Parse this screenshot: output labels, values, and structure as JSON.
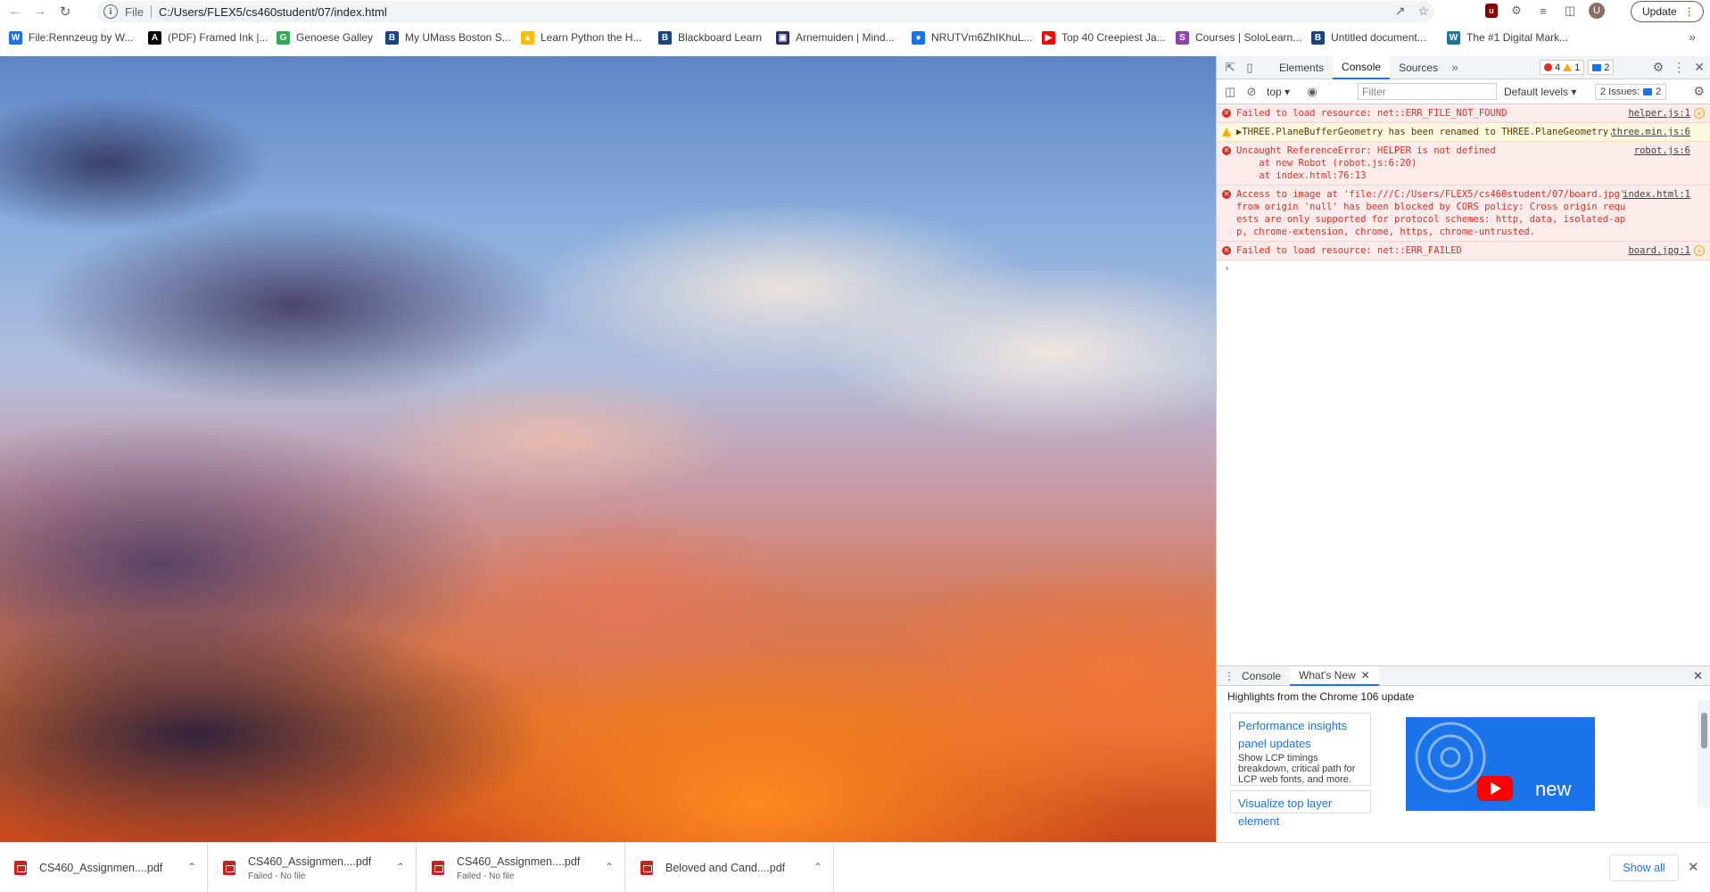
{
  "browser": {
    "url_scheme": "File",
    "url": "C:/Users/FLEX5/cs460student/07/index.html",
    "avatar_initial": "U",
    "update_label": "Update"
  },
  "bookmarks": [
    {
      "label": "File:Rennzeug by W...",
      "icon": "wiki-icon",
      "color": "#1a73e8"
    },
    {
      "label": "(PDF) Framed Ink |...",
      "icon": "academia-icon",
      "color": "#000000"
    },
    {
      "label": "Genoese Galley",
      "icon": "galley-icon",
      "color": "#34a853"
    },
    {
      "label": "My UMass Boston S...",
      "icon": "blackboard-icon",
      "color": "#1a4480"
    },
    {
      "label": "Learn Python the H...",
      "icon": "drive-icon",
      "color": "#fbbc04"
    },
    {
      "label": "Blackboard Learn",
      "icon": "blackboard-icon",
      "color": "#1a4480"
    },
    {
      "label": "Arnemuiden | Mind...",
      "icon": "image-icon",
      "color": "#2b2b6b"
    },
    {
      "label": "NRUTVm6ZhIKhuL...",
      "icon": "map-pin-icon",
      "color": "#1a73e8"
    },
    {
      "label": "Top 40 Creepiest Ja...",
      "icon": "youtube-icon",
      "color": "#ff0000"
    },
    {
      "label": "Courses | SoloLearn...",
      "icon": "sololearn-icon",
      "color": "#8e44ad"
    },
    {
      "label": "Untitled document...",
      "icon": "blackboard-icon",
      "color": "#1a4480"
    },
    {
      "label": "The #1 Digital Mark...",
      "icon": "wordpress-icon",
      "color": "#21759b"
    }
  ],
  "devtools": {
    "tabs": [
      "Elements",
      "Console",
      "Sources"
    ],
    "active_tab": "Console",
    "error_count": "4",
    "warning_count": "1",
    "message_count": "2",
    "context": "top",
    "filter_placeholder": "Filter",
    "levels": "Default levels",
    "issues_label": "2 Issues:",
    "issues_count": "2",
    "messages": [
      {
        "level": "error",
        "text": "Failed to load resource: net::ERR_FILE_NOT_FOUND",
        "source": "helper.js:1"
      },
      {
        "level": "warning",
        "text": "▶THREE.PlaneBufferGeometry has been renamed to THREE.PlaneGeometry.",
        "source": "three.min.js:6"
      },
      {
        "level": "error",
        "text": "Uncaught ReferenceError: HELPER is not defined",
        "line2": "    at new Robot (robot.js:6:20)",
        "line3": "    at index.html:76:13",
        "source": "robot.js:6"
      },
      {
        "level": "error",
        "text": "Access to image at 'file:///C:/Users/FLEX5/cs460student/07/board.jpg' from origin 'null' has been blocked by CORS policy: Cross origin requests are only supported for protocol schemes: http, data, isolated-app, chrome-extension, chrome, https, chrome-untrusted.",
        "source": "index.html:1"
      },
      {
        "level": "error",
        "text": "Failed to load resource: net::ERR_FAILED",
        "source": "board.jpg:1"
      }
    ],
    "drawer": {
      "tabs": [
        "Console",
        "What's New"
      ],
      "active_tab": "What's New",
      "heading": "Highlights from the Chrome 106 update",
      "card1_title": "Performance insights panel updates",
      "card1_desc": "Show LCP timings breakdown, critical path for LCP web fonts, and more.",
      "card2_title": "Visualize top layer element",
      "banner_text": "new"
    }
  },
  "downloads": [
    {
      "name": "CS460_Assignmen....pdf",
      "status": ""
    },
    {
      "name": "CS460_Assignmen....pdf",
      "status": "Failed - No file"
    },
    {
      "name": "CS460_Assignmen....pdf",
      "status": "Failed - No file"
    },
    {
      "name": "Beloved and Cand....pdf",
      "status": ""
    }
  ],
  "show_all_label": "Show all"
}
